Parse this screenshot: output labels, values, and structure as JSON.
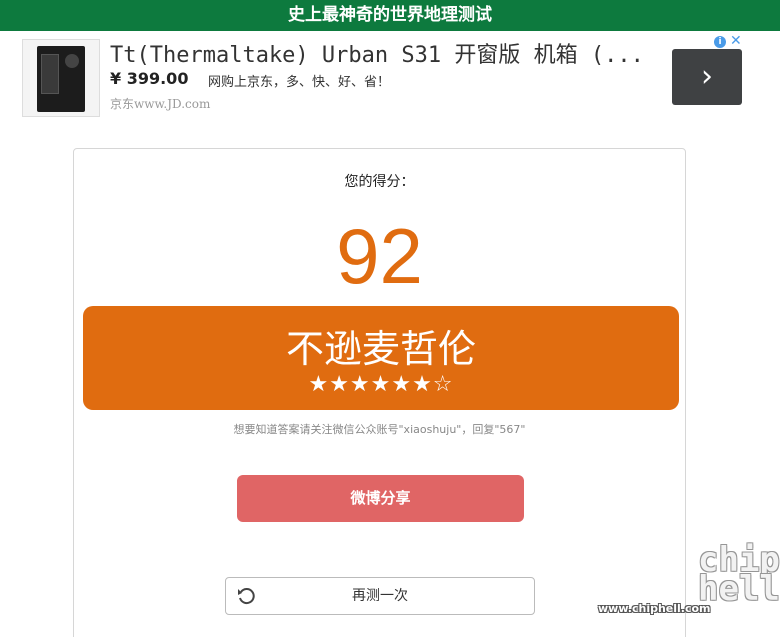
{
  "header": {
    "title": "史上最神奇的世界地理测试"
  },
  "ad": {
    "title": "Tt(Thermaltake) Urban S31 开窗版 机箱 (...",
    "price": "¥ 399.00",
    "slogan": "网购上京东，多、快、好、省！",
    "domain": "京东www.JD.com",
    "info_icon": "info-icon",
    "close_icon": "close-icon",
    "arrow_icon": "chevron-right-icon"
  },
  "result": {
    "score_label": "您的得分：",
    "score": "92",
    "title": "不逊麦哲伦",
    "stars": "★★★★★★☆",
    "rating": {
      "filled": 6,
      "total": 7
    },
    "hint": "想要知道答案请关注微信公众账号\"xiaoshuju\"，回复\"567\""
  },
  "actions": {
    "share_label": "微博分享",
    "retry_label": "再测一次",
    "retry_icon": "refresh-icon"
  },
  "watermark": {
    "logo": "chip hell",
    "url": "www.chiphell.com"
  },
  "colors": {
    "header": "#0d7a3e",
    "accent": "#e06c10",
    "share": "#e06565"
  }
}
